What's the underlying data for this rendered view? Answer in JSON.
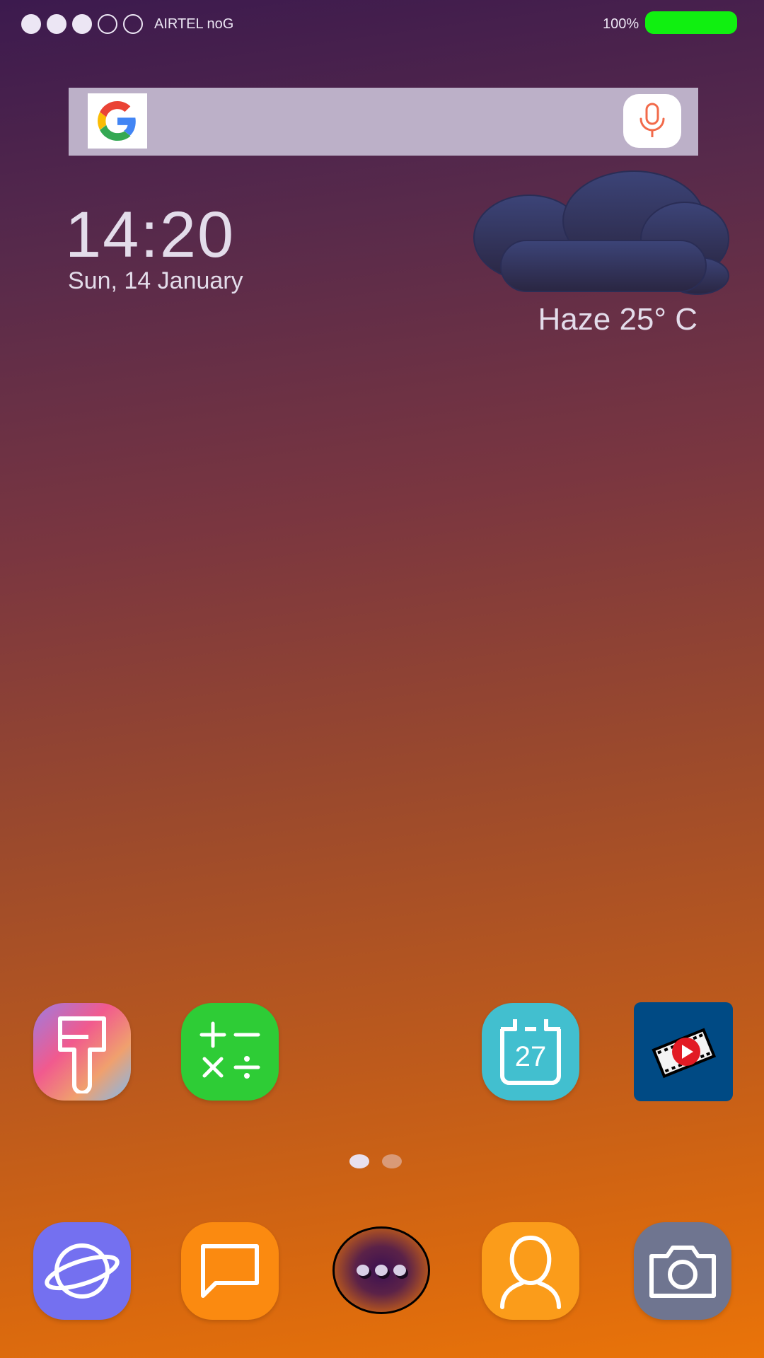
{
  "status_bar": {
    "signal_bars": [
      true,
      true,
      true,
      false,
      false
    ],
    "carrier": "AIRTEL noG",
    "battery_text": "100%",
    "battery_level": 1.0,
    "battery_color": "#10f010"
  },
  "search": {
    "logo_icon": "google-g-icon",
    "mic_icon": "microphone-icon",
    "mic_color": "#f26a4a"
  },
  "clock": {
    "time": "14:20",
    "date": "Sun, 14 January"
  },
  "weather": {
    "icon": "cloud-icon",
    "text": "Haze 25° C"
  },
  "home_apps": [
    {
      "icon": "theme-brush-icon",
      "color": "#f15a8e"
    },
    {
      "icon": "calculator-icon",
      "color": "#2ecc36"
    },
    {
      "icon": "calendar-icon",
      "day": "27",
      "color": "#42bfcf"
    },
    {
      "icon": "video-play-icon",
      "color": "#004a84"
    }
  ],
  "page_indicator": {
    "count": 2,
    "active": 0
  },
  "dock": [
    {
      "icon": "internet-planet-icon",
      "color": "#7470f0"
    },
    {
      "icon": "messages-icon",
      "color": "#fb8a10"
    },
    {
      "icon": "apps-drawer-icon"
    },
    {
      "icon": "contacts-icon",
      "color": "#fb9c1a"
    },
    {
      "icon": "camera-icon",
      "color": "#6f7590"
    }
  ]
}
